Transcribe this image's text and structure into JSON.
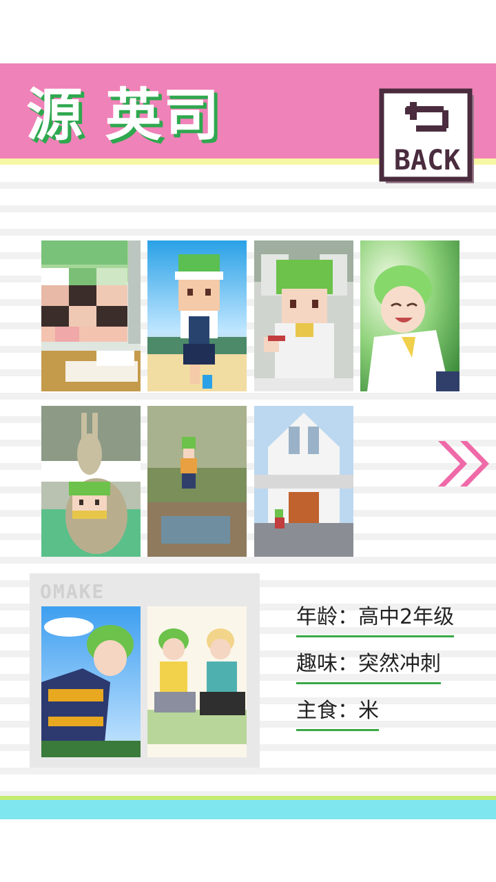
{
  "header": {
    "title": "源 英司",
    "back_label": "BACK",
    "back_icon": "return-arrow-icon"
  },
  "gallery": {
    "items": [
      {
        "name": "pixel-closeup-classroom"
      },
      {
        "name": "pixel-running-stadium"
      },
      {
        "name": "pixel-white-shirt"
      },
      {
        "name": "anime-smiling-forest"
      },
      {
        "name": "pixel-kangaroo-statue"
      },
      {
        "name": "creek-standing"
      },
      {
        "name": "church-running"
      }
    ],
    "next_icon": "double-chevron-right-icon"
  },
  "omake": {
    "label": "OMAKE",
    "items": [
      {
        "name": "omake-athlete-sky"
      },
      {
        "name": "omake-gaming-friends"
      }
    ]
  },
  "profile": {
    "rows": [
      {
        "label": "年龄",
        "sep": "：",
        "value": "高中2年级"
      },
      {
        "label": "趣味",
        "sep": "：",
        "value": "突然冲刺"
      },
      {
        "label": "主食",
        "sep": "：",
        "value": "米"
      }
    ]
  },
  "colors": {
    "header_pink": "#ef82b8",
    "title_shadow_green": "#2fa84f",
    "arrow_pink": "#ef6aa8",
    "underline_green": "#39a845",
    "footer_cyan": "#7ee6ef"
  }
}
